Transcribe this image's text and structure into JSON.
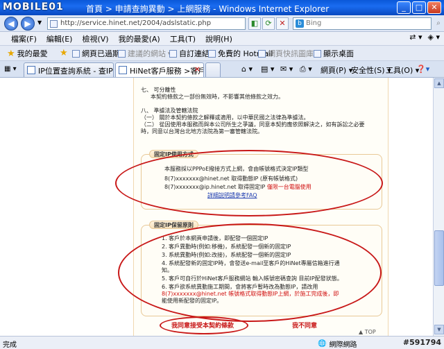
{
  "window": {
    "logo": "MOBILE01",
    "title": "首頁 > 申請查詢異動 > 上網服務 - Windows Internet Explorer"
  },
  "address": {
    "url": "http://service.hinet.net/2004/adslstatic.php",
    "search_placeholder": "Bing"
  },
  "menu": {
    "items": [
      "檔案(F)",
      "編輯(E)",
      "檢視(V)",
      "我的最愛(A)",
      "工具(T)",
      "說明(H)"
    ]
  },
  "favorites": {
    "label": "我的最愛",
    "items": [
      "網頁已過期",
      "建議的網站",
      "自訂連結",
      "免費的 Hotmail",
      "網頁快訊圖庫",
      "顯示桌面"
    ]
  },
  "tabs": [
    {
      "label": "IP位置查詢系統 - 查IP位置..."
    },
    {
      "label": "HiNet客戶服務 >客戶服..."
    }
  ],
  "command_bar": {
    "page": "網頁(P)",
    "safety": "安全性(S)",
    "tools": "工具(O)"
  },
  "document": {
    "clause7_title": "七、 可分離性",
    "clause7_body": "本契約條款之一部份無效時，不影響其他條款之效力。",
    "clause8_title": "八、 準據法及管轄法院",
    "clause8_l1": "（一） 關於本契約條款之解釋或適用，以中華民國之法律為準據法。",
    "clause8_l2": "（二） 從因使用本服務而與本公司所生之爭議，同意本契約應依照解決之，如有訴訟之必要",
    "clause8_l3": "時，同意以台灣台北地方法院為第一審管轄法院。",
    "section1_label": "固定IP使用方式",
    "section1_l1": "本服務採以PPPoE撥接方式上網，會由帳號格式決定IP類型",
    "section1_l2": "8(7)xxxxxxx@hinet.net 取得動態IP (原有帳號格式)",
    "section1_l3a": "8(7)xxxxxxx@ip.hinet.net 取得固定IP",
    "section1_l3b": "僅限一台電腦使用",
    "section1_link": "詳細說明請參考FAQ",
    "section2_label": "固定IP保留原則",
    "section2_items": [
      "1.  客戶於本網頁申請後，即配發一個固定IP",
      "2.  客戶異動時(例如:移機)，系統配發一個新的固定IP",
      "3.  系統異動時(例如:改接)，系統配發一個新的固定IP",
      "4.  系統配發新的固定IP時，會發送e-mail至客戶的HiNet專屬信箱進行通",
      "     知。",
      "5.  客戶可自行於HiNet客戶服務網站 輸入帳號密碼查詢 目前IP配發狀態。",
      "6.  客戶欲系統異動施工期間，會將客戶暫時改為動態IP，請改用",
      "     8(7)xxxxxxx@hinet.net 帳號格式取得動態IP上網，於施工完成後，即",
      "     能使用新配發的固定IP。"
    ],
    "agree": "我同意接受本契約條款",
    "disagree": "我不同意",
    "top_link": "▲ TOP"
  },
  "status": {
    "text": "完成",
    "zone": "網際網路",
    "watermark": "#591794"
  }
}
